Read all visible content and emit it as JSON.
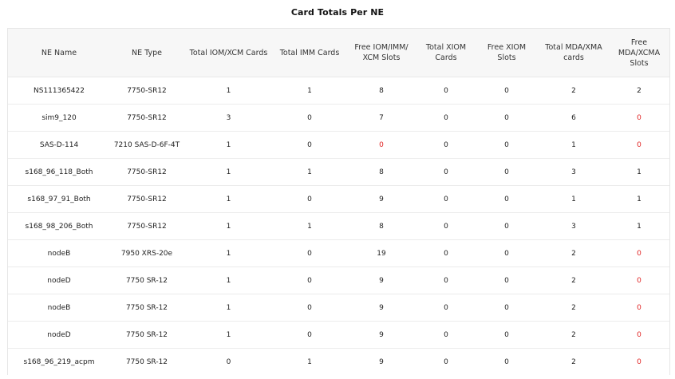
{
  "title": "Card Totals Per NE",
  "colors": {
    "alert": "#e02020",
    "header_bg": "#f7f7f7",
    "border": "#e6e6e6"
  },
  "columns": [
    "NE Name",
    "NE Type",
    "Total IOM/XCM Cards",
    "Total IMM Cards",
    "Free IOM/IMM/ XCM Slots",
    "Total XIOM Cards",
    "Free XIOM Slots",
    "Total MDA/XMA cards",
    "Free MDA/XCMA Slots"
  ],
  "rows": [
    [
      "NS111365422",
      "7750-SR12",
      "1",
      "1",
      "8",
      "0",
      "0",
      "2",
      "2"
    ],
    [
      "sim9_120",
      "7750-SR12",
      "3",
      "0",
      "7",
      "0",
      "0",
      "6",
      "0"
    ],
    [
      "SAS-D-114",
      "7210 SAS-D-6F-4T",
      "1",
      "0",
      "0",
      "0",
      "0",
      "1",
      "0"
    ],
    [
      "s168_96_118_Both",
      "7750-SR12",
      "1",
      "1",
      "8",
      "0",
      "0",
      "3",
      "1"
    ],
    [
      "s168_97_91_Both",
      "7750-SR12",
      "1",
      "0",
      "9",
      "0",
      "0",
      "1",
      "1"
    ],
    [
      "s168_98_206_Both",
      "7750-SR12",
      "1",
      "1",
      "8",
      "0",
      "0",
      "3",
      "1"
    ],
    [
      "nodeB",
      "7950 XRS-20e",
      "1",
      "0",
      "19",
      "0",
      "0",
      "2",
      "0"
    ],
    [
      "nodeD",
      "7750 SR-12",
      "1",
      "0",
      "9",
      "0",
      "0",
      "2",
      "0"
    ],
    [
      "nodeB",
      "7750 SR-12",
      "1",
      "0",
      "9",
      "0",
      "0",
      "2",
      "0"
    ],
    [
      "nodeD",
      "7750 SR-12",
      "1",
      "0",
      "9",
      "0",
      "0",
      "2",
      "0"
    ],
    [
      "s168_96_219_acpm",
      "7750 SR-12",
      "0",
      "1",
      "9",
      "0",
      "0",
      "2",
      "0"
    ]
  ],
  "alert_cells": [
    [
      1,
      8
    ],
    [
      2,
      4
    ],
    [
      2,
      8
    ],
    [
      6,
      8
    ],
    [
      7,
      8
    ],
    [
      8,
      8
    ],
    [
      9,
      8
    ],
    [
      10,
      8
    ]
  ]
}
